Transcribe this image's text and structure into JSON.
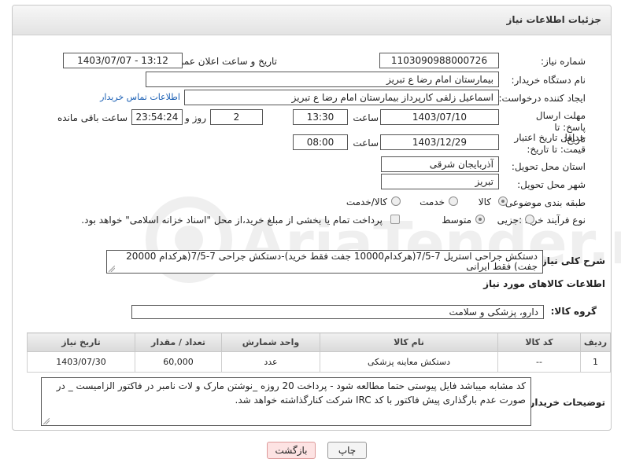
{
  "header": {
    "title": "جزئیات اطلاعات نیاز"
  },
  "fields": {
    "need_number_label": "شماره نیاز:",
    "need_number": "1103090988000726",
    "announce_label": "تاریخ و ساعت اعلان عمومی:",
    "announce_value": "1403/07/07 - 13:12",
    "buyer_org_label": "نام دستگاه خریدار:",
    "buyer_org": "بیمارستان امام رضا  ع  تبریز",
    "requester_label": "ایجاد کننده درخواست:",
    "requester": "اسماعیل زلفی کارپرداز بیمارستان امام رضا  ع  تبریز",
    "contact_link": "اطلاعات تماس خریدار",
    "deadline_label": "مهلت ارسال پاسخ: تا تاریخ:",
    "deadline_date": "1403/07/10",
    "time_label": "ساعت",
    "deadline_time": "13:30",
    "days_value": "2",
    "days_label": "روز و",
    "remaining_time": "23:54:24",
    "remaining_label": "ساعت باقی مانده",
    "validity_label": "حداقل تاریخ اعتبار قیمت: تا تاریخ:",
    "validity_date": "1403/12/29",
    "validity_time": "08:00",
    "province_label": "استان محل تحویل:",
    "province": "آذربایجان شرقی",
    "city_label": "شهر محل تحویل:",
    "city": "تبریز",
    "category_label": "طبقه بندی موضوعی:",
    "category_options": [
      "کالا",
      "خدمت",
      "کالا/خدمت"
    ],
    "process_label": "نوع فرآیند خرید :",
    "process_options": [
      "جزیی",
      "متوسط"
    ],
    "payment_note": "پرداخت تمام یا بخشی از مبلغ خرید،از محل \"اسناد خزانه اسلامی\" خواهد بود."
  },
  "general_desc": {
    "label": "شرح کلی نیاز:",
    "text": "دستکش جراحی استریل 7-7/5(هرکدام10000 جفت فقط خرید)-دستکش جراحی 7-7/5(هرکدام 20000 جفت) فقط ایرانی"
  },
  "goods_section": {
    "title": "اطلاعات کالاهای مورد نیاز",
    "group_label": "گروه کالا:",
    "group_value": "دارو، پزشکی و سلامت"
  },
  "table": {
    "headers": [
      "ردیف",
      "کد کالا",
      "نام کالا",
      "واحد شمارش",
      "تعداد / مقدار",
      "تاریخ نیاز"
    ],
    "rows": [
      [
        "1",
        "--",
        "دستکش معاینه پزشکی",
        "عدد",
        "60,000",
        "1403/07/30"
      ]
    ]
  },
  "buyer_notes": {
    "label": "توضیحات خریدار:",
    "text": "کد مشابه میباشد فایل پیوستی حتما مطالعه شود - پرداخت 20 روزه _نوشتن مارک و لات نامبر در فاکتور الزامیست _   در صورت عدم بارگذاری پیش فاکتور با کد IRC  شرکت کنارگذاشته خواهد شد."
  },
  "buttons": {
    "print": "چاپ",
    "back": "بازگشت"
  },
  "watermark": {
    "text": "AriaTender.neT"
  },
  "colors": {
    "link": "#1a5fb4",
    "back_bg": "#fde3e3",
    "print_bg": "#f4f4f4"
  }
}
